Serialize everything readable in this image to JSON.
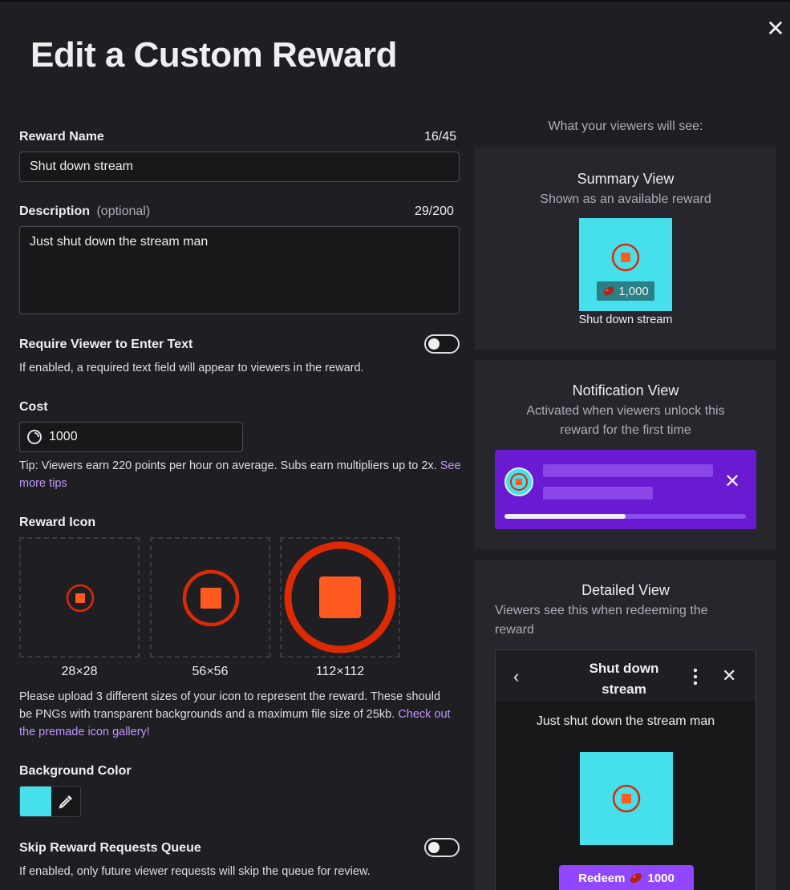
{
  "modal": {
    "title": "Edit a Custom Reward",
    "close_icon": "close-icon"
  },
  "reward_name": {
    "label": "Reward Name",
    "counter": "16/45",
    "value": "Shut down stream"
  },
  "description": {
    "label": "Description",
    "optional": "(optional)",
    "counter": "29/200",
    "value": "Just shut down the stream man"
  },
  "require_text": {
    "label": "Require Viewer to Enter Text",
    "help": "If enabled, a required text field will appear to viewers in the reward.",
    "enabled": false
  },
  "cost": {
    "label": "Cost",
    "value": "1000",
    "tip": "Tip: Viewers earn 220 points per hour on average. Subs earn multipliers up to 2x.",
    "tip_link": "See more tips"
  },
  "reward_icon": {
    "label": "Reward Icon",
    "sizes": [
      "28×28",
      "56×56",
      "112×112"
    ],
    "help": "Please upload 3 different sizes of your icon to represent the reward. These should be PNGs with transparent backgrounds and a maximum file size of 25kb.",
    "help_link": "Check out the premade icon gallery!"
  },
  "background_color": {
    "label": "Background Color",
    "color": "#45e0ec",
    "picker_icon": "eyedropper-icon"
  },
  "skip_queue": {
    "label": "Skip Reward Requests Queue",
    "help": "If enabled, only future viewer requests will skip the queue for review.",
    "enabled": false
  },
  "preview": {
    "heading": "What your viewers will see:",
    "summary": {
      "title": "Summary View",
      "subtitle": "Shown as an available reward",
      "cost": "1,000",
      "name": "Shut down stream"
    },
    "notification": {
      "title": "Notification View",
      "subtitle_line1": "Activated when viewers unlock this",
      "subtitle_line2": "reward for the first time",
      "progress": 0.5
    },
    "detailed": {
      "title": "Detailed View",
      "subtitle_line1": "Viewers see this when redeeming the",
      "subtitle_line2": "reward",
      "header_line1": "Shut down",
      "header_line2": "stream",
      "description": "Just shut down the stream man",
      "redeem_label": "Redeem",
      "redeem_cost": "1000"
    }
  },
  "colors": {
    "accent_purple": "#9147ff",
    "link": "#bf94ff",
    "icon_orange": "#ff5a1f",
    "icon_ring": "#dd2a05",
    "teal": "#45e0ec"
  }
}
